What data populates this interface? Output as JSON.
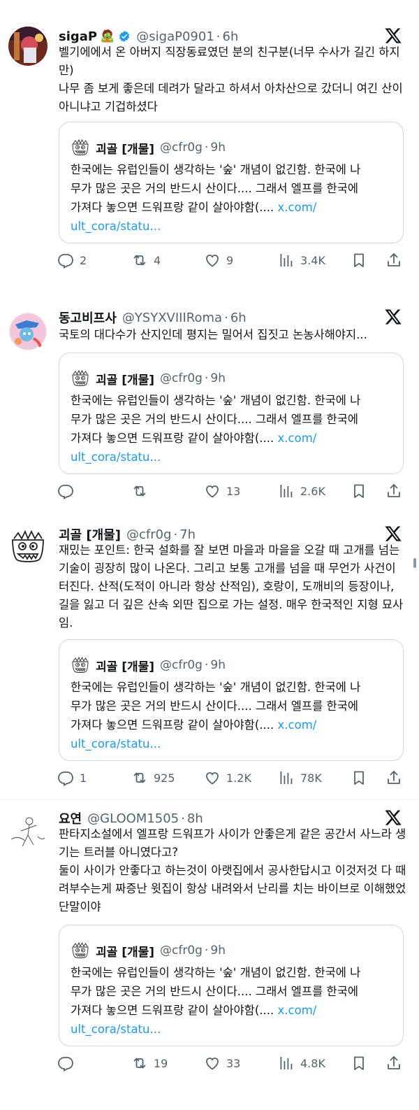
{
  "tweets": [
    {
      "name": "sigaP",
      "badge_emoji": "🧟",
      "verified": true,
      "handle": "@sigaP0901",
      "dot": "·",
      "time": "6h",
      "text": "벨기에에서 온 아버지 직장동료였던 분의 친구분(너무 수사가 길긴 하지만)\n나무 좀 보게 좋은데 데려가 달라고 하셔서 아차산으로 갔더니 여긴 산이 아니냐고 기겁하셨다",
      "actions": {
        "reply": "2",
        "retweet": "4",
        "like": "9",
        "views": "3.4K"
      }
    },
    {
      "name": "동고비프사",
      "handle": "@YSYXVIIIRoma",
      "dot": "·",
      "time": "6h",
      "text": "국토의 대다수가 산지인데 평지는 밀어서 집짓고 논농사해야지...",
      "actions": {
        "reply": "",
        "retweet": "",
        "like": "13",
        "views": "2.6K"
      }
    },
    {
      "name": "괴골 [개물]",
      "handle": "@cfr0g",
      "dot": "·",
      "time": "7h",
      "text": "재밌는 포인트: 한국 설화를 잘 보면 마을과 마을을 오갈 때 고개를 넘는 기술이 굉장히 많이 나온다. 그리고 보통 고개를 넘을 때 무언가 사건이 터진다. 산적(도적이 아니라 항상 산적임), 호랑이, 도깨비의 등장이나, 길을 잃고 더 깊은 산속 외딴 집으로 가는 설정. 매우 한국적인 지형 묘사임.",
      "actions": {
        "reply": "1",
        "retweet": "925",
        "like": "1.2K",
        "views": "78K"
      }
    },
    {
      "name": "요연",
      "handle": "@GLOOM1505",
      "dot": "·",
      "time": "8h",
      "text": "판타지소설에서 엘프랑 드워프가 사이가 안좋은게 같은 공간서 사느라 생기는 트러블 아니였다고?\n둘이 사이가 안좋다고 하는것이 아랫집에서 공사한답시고 이것저것 다 때려부수는게 짜증난 윗집이 항상 내려와서 난리를 치는 바이브로 이해했었단말이야",
      "actions": {
        "reply": "",
        "retweet": "19",
        "like": "33",
        "views": "4.8K"
      }
    }
  ],
  "quote": {
    "name": "괴골 [개물]",
    "handle": "@cfr0g",
    "dot": "·",
    "time": "9h",
    "line1": "한국에는 유럽인들이 생각하는 '숲' 개념이 없긴함. 한국에 나",
    "line2": "무가 많은 곳은 거의 반드시 산이다.... 그래서 엘프를 한국에",
    "line3": "가져다 놓으면 드워프랑 같이 살아야함(.... ",
    "link1": "x.com/",
    "link2": "ult_cora/statu..."
  },
  "colors": {
    "accent": "#1d9bf0",
    "secondary": "#536471",
    "border": "#cfd9de"
  },
  "icons": [
    "x-logo-icon",
    "verified-badge-icon",
    "reply-icon",
    "retweet-icon",
    "like-icon",
    "views-icon",
    "bookmark-icon",
    "share-icon"
  ]
}
